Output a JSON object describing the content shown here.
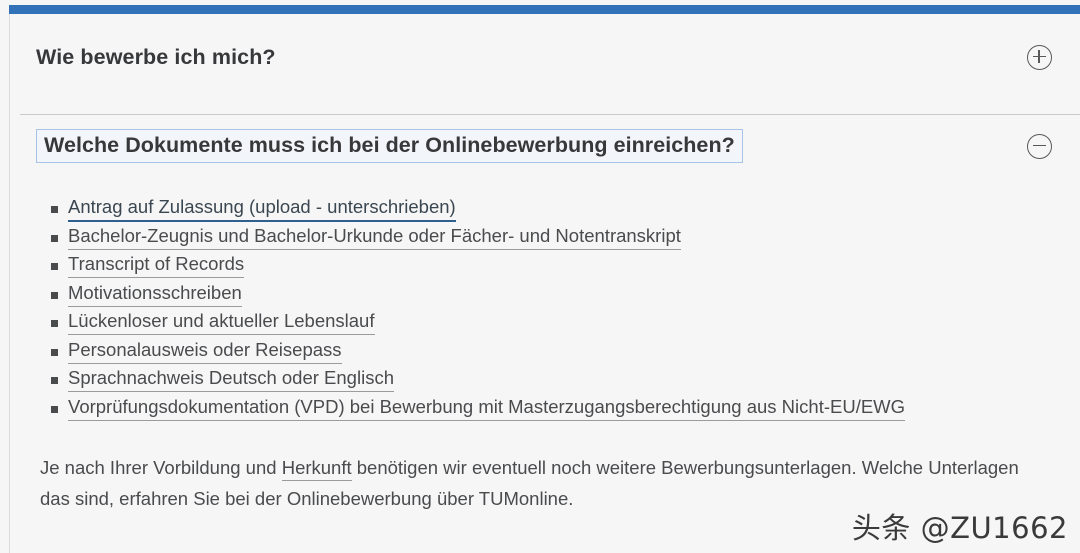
{
  "theme": {
    "accent_bar_color": "#3272b8",
    "page_background": "#f6f6f7",
    "text_color": "#4a4b4d",
    "heading_color": "#37383a",
    "link_underline_color": "#9a9b9d",
    "primary_link_underline_color": "#2f5f8f",
    "focus_border_color": "#a7c4e4",
    "focus_fill_color": "#f2f5f9",
    "divider_color": "#c9c9cb"
  },
  "accordion": {
    "items": [
      {
        "id": "wie-bewerbe-ich-mich",
        "title": "Wie bewerbe ich mich?",
        "expanded": false,
        "toggle_icon": "plus-circle-icon"
      },
      {
        "id": "welche-dokumente",
        "title": "Welche Dokumente muss ich bei der Onlinebewerbung einreichen?",
        "expanded": true,
        "focused": true,
        "toggle_icon": "minus-circle-icon"
      }
    ]
  },
  "content": {
    "documents": [
      {
        "label": "Antrag auf Zulassung (upload - unterschrieben)",
        "primary": true
      },
      {
        "label": "Bachelor-Zeugnis und Bachelor-Urkunde oder Fächer- und Notentranskript",
        "primary": false
      },
      {
        "label": "Transcript of Records",
        "primary": false
      },
      {
        "label": "Motivationsschreiben",
        "primary": false
      },
      {
        "label": "Lückenloser und aktueller Lebenslauf",
        "primary": false
      },
      {
        "label": "Personalausweis oder Reisepass",
        "primary": false
      },
      {
        "label": "Sprachnachweis Deutsch oder Englisch",
        "primary": false
      },
      {
        "label": "Vorprüfungsdokumentation (VPD) bei Bewerbung mit Masterzugangsberechtigung aus Nicht-EU/EWG",
        "primary": false
      }
    ],
    "note": {
      "part1": "Je nach Ihrer Vorbildung und ",
      "link": "Herkunft",
      "part2": " benötigen wir eventuell noch weitere Bewerbungsunterlagen. Welche Unterlagen das sind, erfahren Sie bei der Onlinebewerbung über TUMonline."
    }
  },
  "watermark": {
    "text": "头条 @ZU1662"
  }
}
